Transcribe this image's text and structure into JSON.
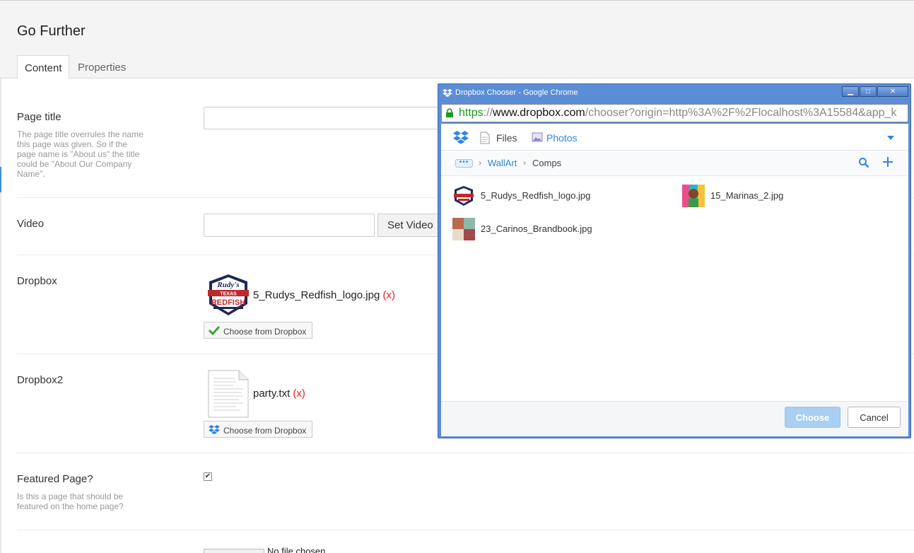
{
  "page": {
    "title": "Go Further",
    "tabs": [
      {
        "label": "Content",
        "active": true
      },
      {
        "label": "Properties",
        "active": false
      }
    ]
  },
  "fields": {
    "page_title": {
      "label": "Page title",
      "help": "The page title overrules the name this page was given. So if the page name is \"About us\" the title could be \"About Our Company Name\".",
      "value": ""
    },
    "video": {
      "label": "Video",
      "value": "",
      "button": "Set Video"
    },
    "dropbox": {
      "label": "Dropbox",
      "file": "5_Rudys_Redfish_logo.jpg",
      "remove": "(x)",
      "button": "Choose from Dropbox",
      "logo_text": {
        "top": "Rudy's",
        "mid": "TEXAS",
        "main": "REDFISH"
      }
    },
    "dropbox2": {
      "label": "Dropbox2",
      "file": "party.txt",
      "remove": "(x)",
      "button": "Choose from Dropbox"
    },
    "featured": {
      "label": "Featured Page?",
      "help": "Is this a page that should be featured on the home page?",
      "checked": true
    },
    "file_upload": {
      "status": "No file chosen"
    }
  },
  "chooser": {
    "window_title": "Dropbox Chooser - Google Chrome",
    "url_scheme": "https",
    "url_sep": "://",
    "url_host": "www.dropbox.com",
    "url_path": "/chooser?origin=http%3A%2F%2Flocalhost%3A15584&app_k",
    "nav": {
      "files": "Files",
      "photos": "Photos"
    },
    "breadcrumb": {
      "more": "•••",
      "parent": "WallArt",
      "current": "Comps",
      "sep": "›"
    },
    "files": [
      {
        "name": "5_Rudys_Redfish_logo.jpg"
      },
      {
        "name": "15_Marinas_2.jpg"
      },
      {
        "name": "23_Carinos_Brandbook.jpg"
      }
    ],
    "buttons": {
      "choose": "Choose",
      "cancel": "Cancel"
    },
    "window_controls": {
      "min": "▁",
      "max": "□",
      "close": "✕"
    }
  },
  "colors": {
    "accent": "#2e86de",
    "remove": "#e02020",
    "window_frame": "#5b8ed6",
    "choose_disabled": "#a9cff2",
    "check_green": "#3aa53a"
  },
  "icons": [
    "dropbox-icon",
    "lock-icon",
    "file-icon",
    "photos-icon",
    "search-icon",
    "plus-icon",
    "check-icon",
    "chevron-down-icon"
  ]
}
